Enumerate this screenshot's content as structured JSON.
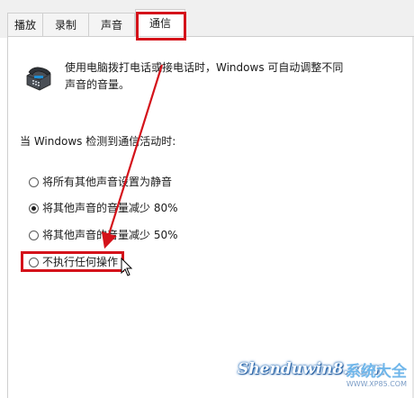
{
  "tabs": [
    {
      "label": "播放",
      "active": false
    },
    {
      "label": "录制",
      "active": false
    },
    {
      "label": "声音",
      "active": false
    },
    {
      "label": "通信",
      "active": true
    }
  ],
  "description_line1": "使用电脑拨打电话或接电话时，Windows 可自动调整不同",
  "description_line2": "声音的音量。",
  "section_label": "当 Windows 检测到通信活动时:",
  "options": [
    {
      "label": "将所有其他声音设置为静音",
      "checked": false
    },
    {
      "label": "将其他声音的音量减少 80%",
      "checked": true
    },
    {
      "label": "将其他声音的音量减少 50%",
      "checked": false
    },
    {
      "label": "不执行任何操作",
      "checked": false
    }
  ],
  "watermark": {
    "brand": "Shenduwin8.com",
    "cn": "系统大全",
    "url": "WWW.XP85.COM"
  },
  "colors": {
    "highlight": "#d4121a",
    "arrow": "#d4121a"
  },
  "icons": [
    "telephone-icon",
    "cursor-icon",
    "arrow-annotation"
  ]
}
